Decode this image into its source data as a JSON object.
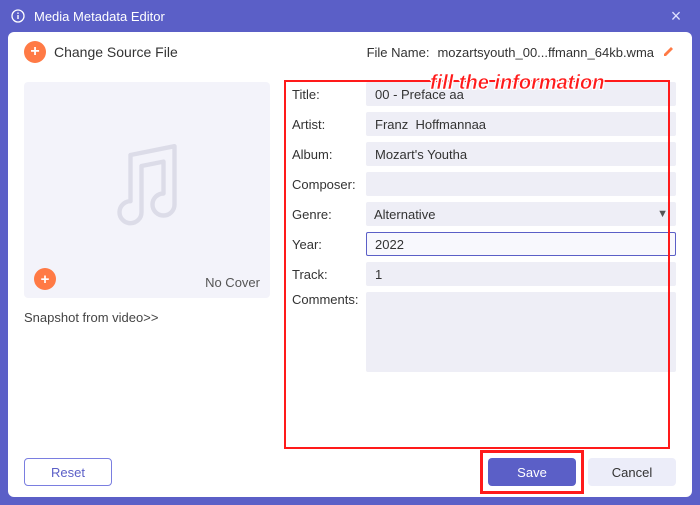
{
  "window": {
    "title": "Media Metadata Editor"
  },
  "header": {
    "change_source": "Change Source File",
    "file_name_label": "File Name:",
    "file_name_value": "mozartsyouth_00...ffmann_64kb.wma"
  },
  "instruction": "fill the information",
  "cover": {
    "no_cover": "No Cover",
    "snapshot_link": "Snapshot from video>>"
  },
  "form": {
    "title_label": "Title:",
    "title_value": "00 - Preface aa",
    "artist_label": "Artist:",
    "artist_value": "Franz  Hoffmannaa",
    "album_label": "Album:",
    "album_value": "Mozart's Youtha",
    "composer_label": "Composer:",
    "composer_value": "",
    "genre_label": "Genre:",
    "genre_value": "Alternative",
    "year_label": "Year:",
    "year_value": "2022",
    "track_label": "Track:",
    "track_value": "1",
    "comments_label": "Comments:",
    "comments_value": ""
  },
  "footer": {
    "reset": "Reset",
    "save": "Save",
    "cancel": "Cancel"
  }
}
